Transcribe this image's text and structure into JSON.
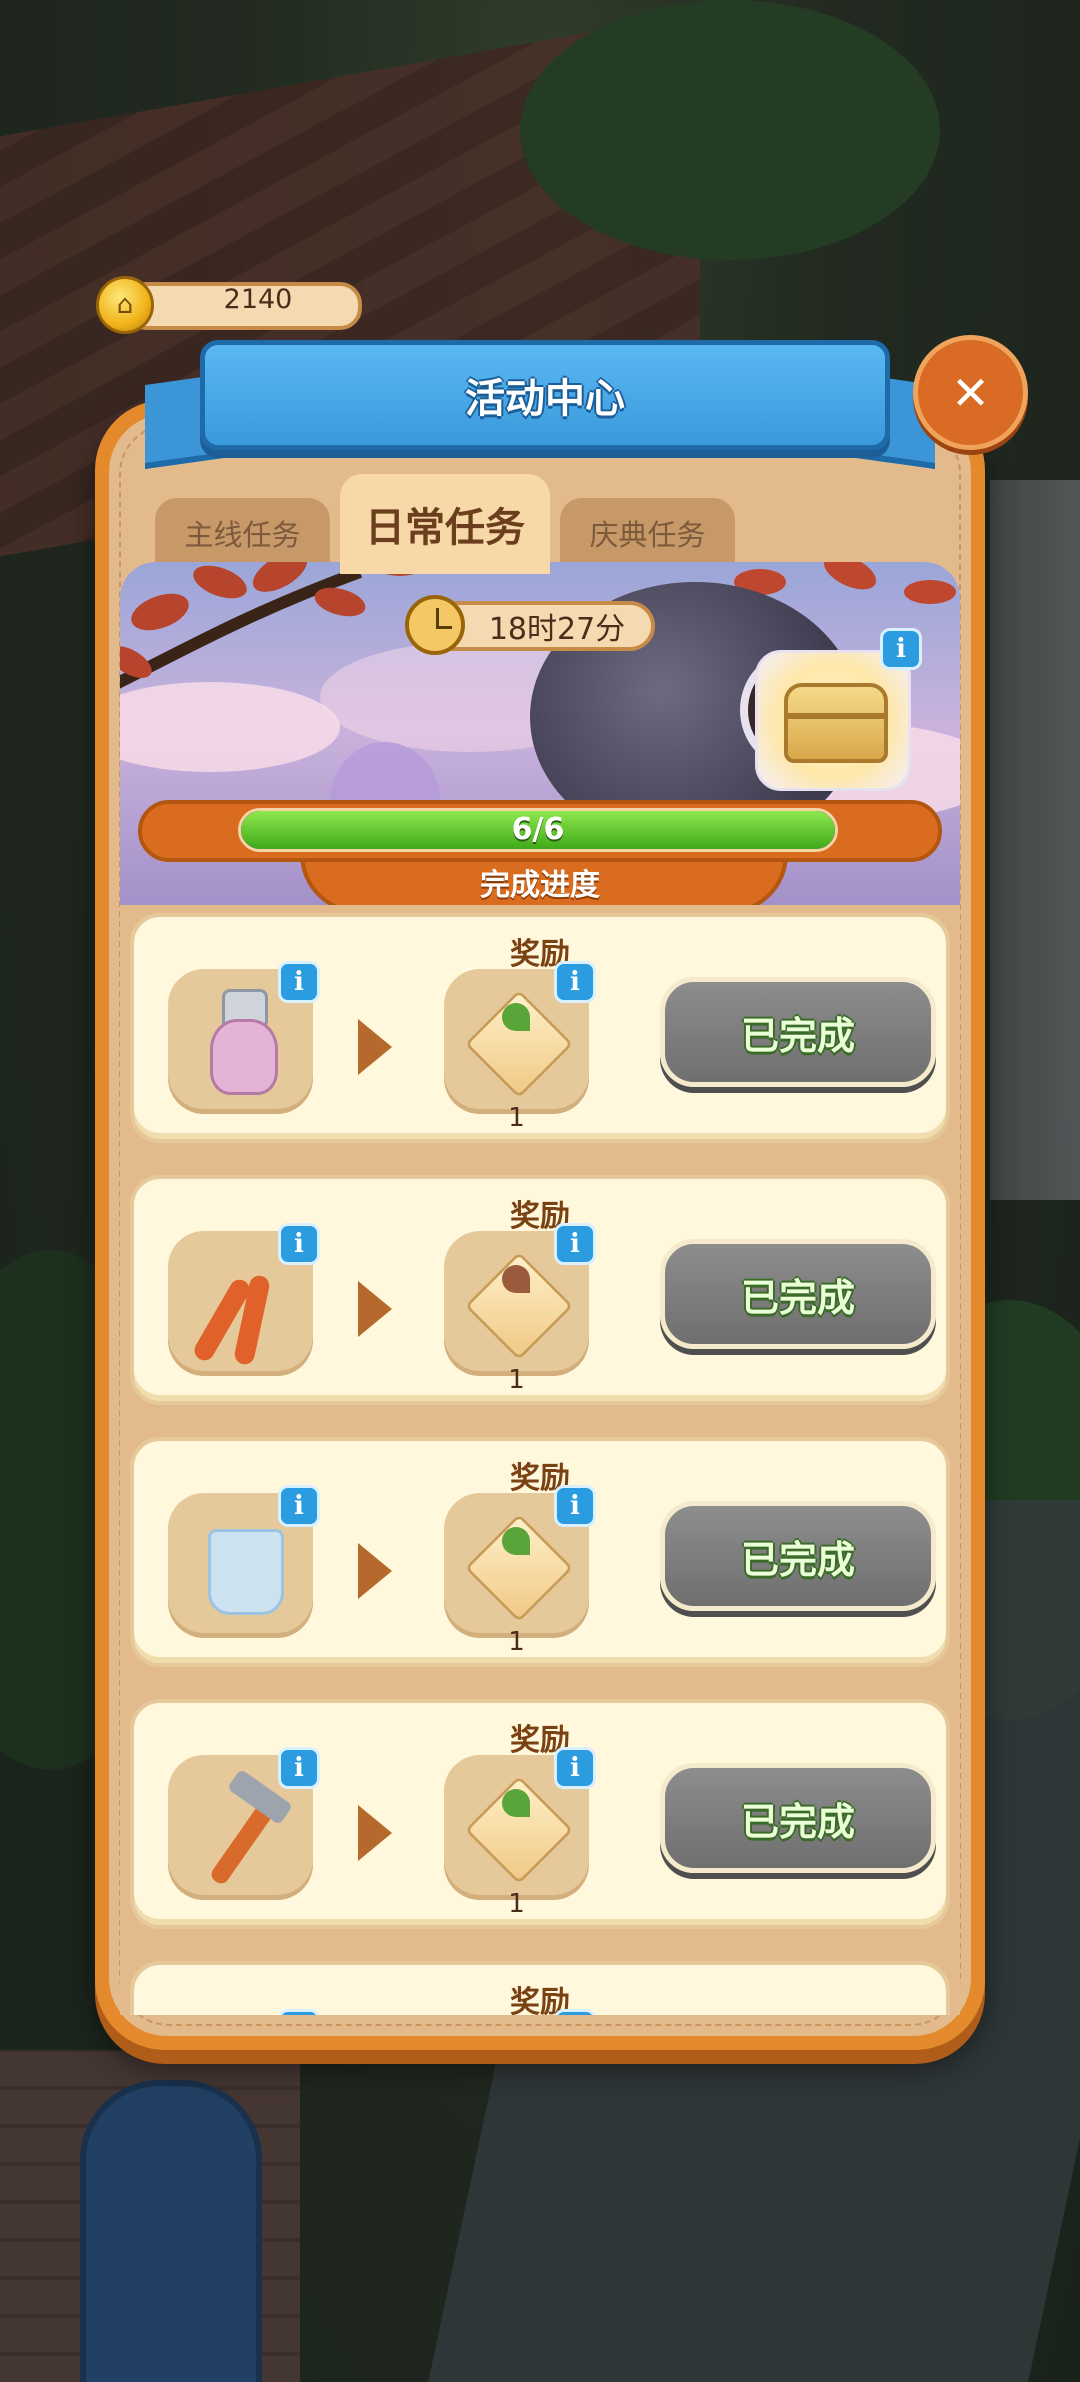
{
  "currency": {
    "icon": "house-coin-icon",
    "value": "2140"
  },
  "header": {
    "title": "活动中心",
    "close_symbol": "✕"
  },
  "tabs": [
    {
      "label": "主线任务",
      "active": false
    },
    {
      "label": "日常任务",
      "active": true
    },
    {
      "label": "庆典任务",
      "active": false
    }
  ],
  "banner": {
    "timer": "18时27分",
    "info_symbol": "i",
    "progress": {
      "text": "6/6",
      "fraction": 1.0,
      "label": "完成进度"
    }
  },
  "tasks": [
    {
      "title": "奖励",
      "item_icon": "spray-bottle-icon",
      "reward_icon": "plant-box-icon",
      "reward_count": "1",
      "button": "已完成"
    },
    {
      "title": "奖励",
      "item_icon": "pliers-icon",
      "reward_icon": "flower-box-icon",
      "reward_count": "1",
      "button": "已完成"
    },
    {
      "title": "奖励",
      "item_icon": "glass-cup-icon",
      "reward_icon": "plant-box-icon",
      "reward_count": "1",
      "button": "已完成"
    },
    {
      "title": "奖励",
      "item_icon": "hammer-icon",
      "reward_icon": "plant-box-icon",
      "reward_count": "1",
      "button": "已完成"
    },
    {
      "title": "奖励"
    }
  ],
  "colors": {
    "accent_blue": "#3a99dc",
    "panel_orange": "#e58a2c",
    "progress_green": "#3fa91a",
    "done_gray": "#7a7a7a"
  }
}
